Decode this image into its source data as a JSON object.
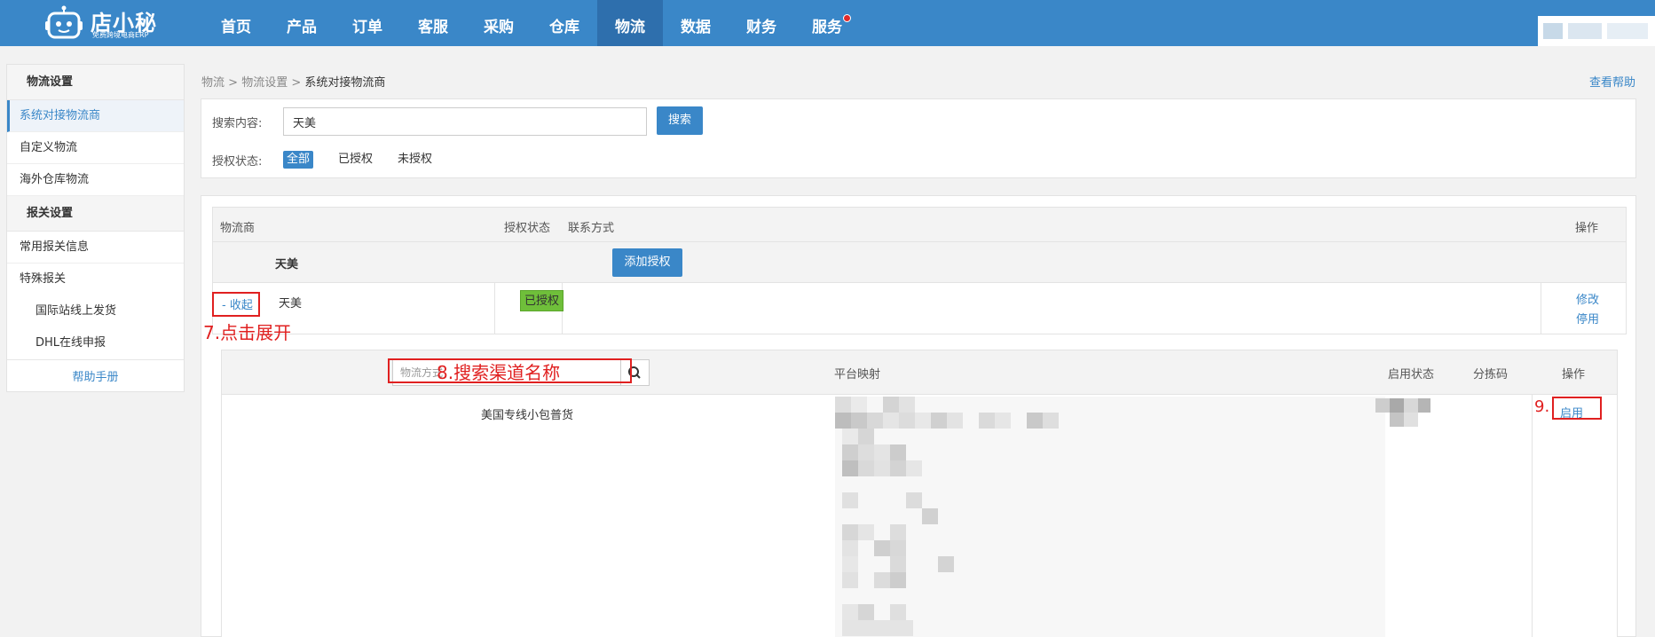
{
  "header": {
    "brand": "店小秘",
    "tagline": "免费跨境电商ERP",
    "nav": [
      {
        "label": "首页",
        "active": false
      },
      {
        "label": "产品",
        "active": false
      },
      {
        "label": "订单",
        "active": false
      },
      {
        "label": "客服",
        "active": false
      },
      {
        "label": "采购",
        "active": false
      },
      {
        "label": "仓库",
        "active": false
      },
      {
        "label": "物流",
        "active": true
      },
      {
        "label": "数据",
        "active": false
      },
      {
        "label": "财务",
        "active": false
      },
      {
        "label": "服务",
        "active": false,
        "badge_dot": true
      }
    ]
  },
  "sidebar": {
    "sections": [
      {
        "title": "物流设置",
        "items": [
          "系统对接物流商",
          "自定义物流",
          "海外仓库物流"
        ]
      },
      {
        "title": "报关设置",
        "items": [
          "常用报关信息",
          "特殊报关",
          "国际站线上发货",
          "DHL在线申报"
        ]
      }
    ],
    "help": "帮助手册"
  },
  "breadcrumb": {
    "items": [
      "物流",
      "物流设置",
      "系统对接物流商"
    ],
    "help_link": "查看帮助"
  },
  "search": {
    "label": "搜索内容:",
    "value": "天美",
    "button": "搜索",
    "status_label": "授权状态:",
    "filters": [
      "全部",
      "已授权",
      "未授权"
    ],
    "active_filter": "全部"
  },
  "table": {
    "headers": {
      "provider": "物流商",
      "auth_status": "授权状态",
      "contact": "联系方式",
      "ops": "操作"
    },
    "provider_name": "天美",
    "add_auth_button": "添加授权",
    "carrier": {
      "toggle": "- 收起",
      "name": "天美",
      "status": "已授权",
      "ops": [
        "修改",
        "停用"
      ]
    },
    "channels": {
      "search_placeholder": "物流方式",
      "headers": {
        "mapping": "平台映射",
        "enable_status": "启用状态",
        "sort_code": "分拣码",
        "ops": "操作"
      },
      "rows": [
        {
          "name": "美国专线小包普货",
          "op": "启用"
        }
      ]
    }
  },
  "annotations": {
    "step7": "7.点击展开",
    "step8": "8.搜索渠道名称",
    "step9": "9."
  },
  "colors": {
    "primary": "#3a87c8",
    "annotation": "#e02020",
    "authorized": "#6fbf3a"
  }
}
